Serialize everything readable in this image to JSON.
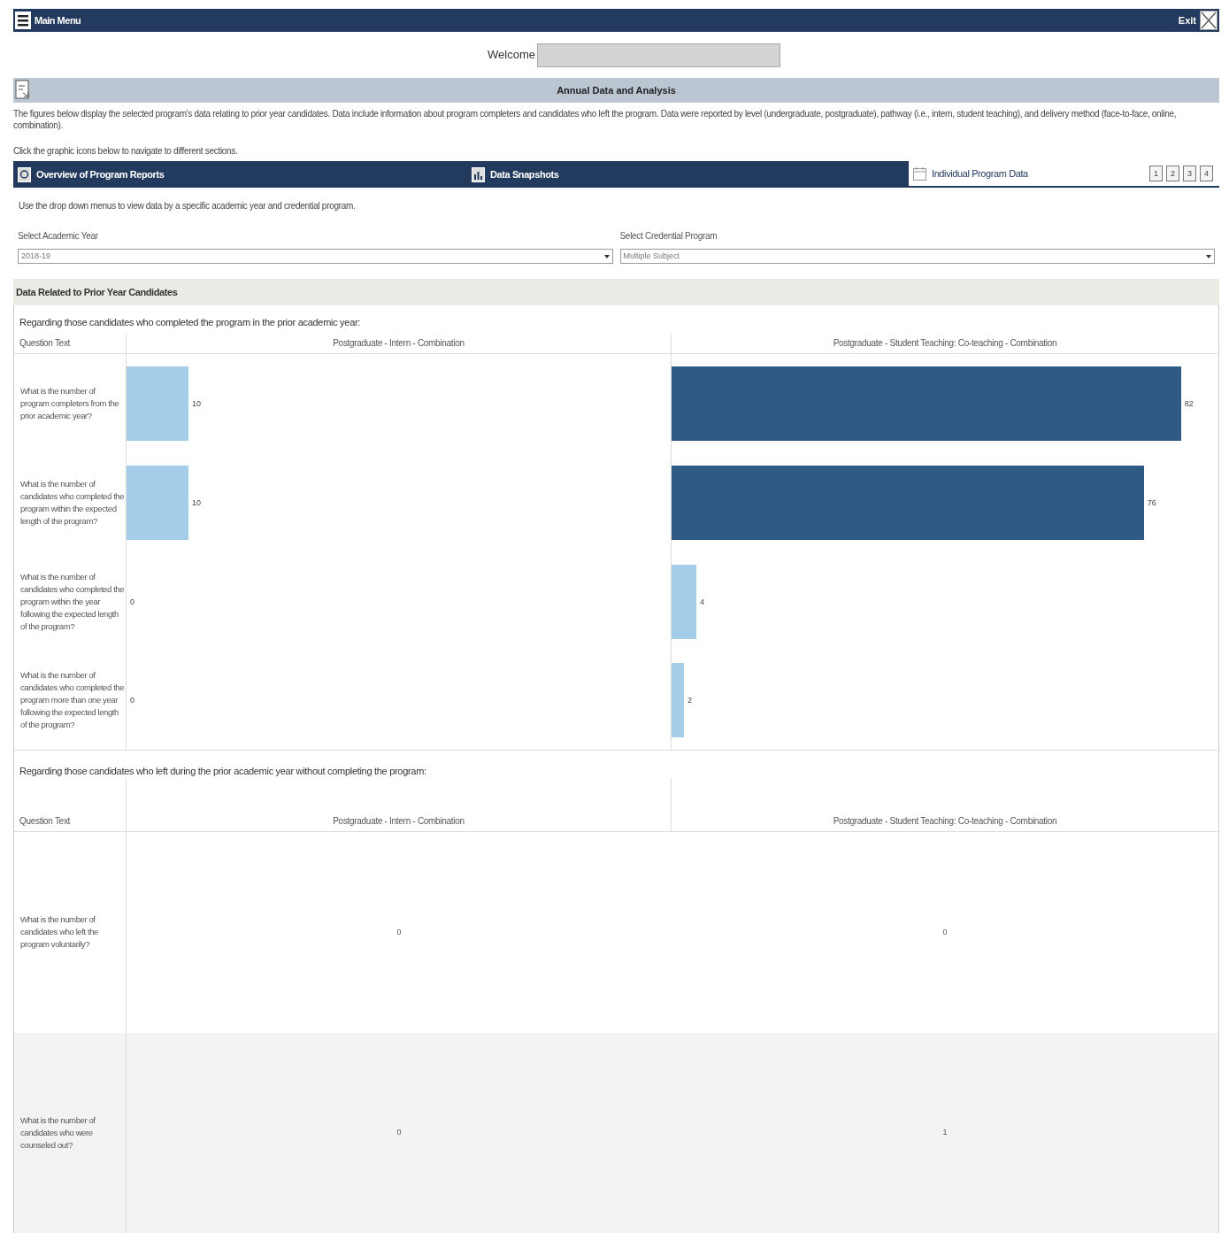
{
  "top_bar": {
    "menu_label": "Main Menu",
    "exit_label": "Exit"
  },
  "welcome": {
    "label": "Welcome"
  },
  "page_header": {
    "title": "Annual Data and Analysis"
  },
  "description": "The figures below display the selected program's data relating to prior year candidates. Data include information about program completers and candidates who left the program. Data were reported by level (undergraduate, postgraduate), pathway (i.e., intern, student teaching), and delivery method (face-to-face, online, combination).",
  "nav_hint": "Click the graphic icons below to navigate to different sections.",
  "nav_tabs": [
    {
      "label": "Overview of Program Reports",
      "selected": false
    },
    {
      "label": "Data Snapshots",
      "selected": false
    },
    {
      "label": "Individual Program Data",
      "selected": true
    }
  ],
  "page_buttons": [
    "1",
    "2",
    "3",
    "4"
  ],
  "filter_hint": "Use the drop down menus to view data by a specific academic year and credential program.",
  "filters": [
    {
      "label": "Select Academic Year",
      "value": "2018-19"
    },
    {
      "label": "Select Credential Program",
      "value": "Multiple Subject"
    }
  ],
  "section": {
    "title": "Data Related to Prior Year Candidates"
  },
  "completers_table": {
    "caption": "Regarding those candidates who completed the program in the prior academic year:",
    "question_header": "Question Text",
    "columns": [
      "Postgraduate - Intern - Combination",
      "Postgraduate - Student Teaching: Co-teaching - Combination"
    ],
    "rows": [
      {
        "question": "What is the number of program completers from the prior academic year?",
        "cells": [
          {
            "value": "10",
            "color": "#a3cde9"
          },
          {
            "value": "82",
            "color": "#2f5a86"
          }
        ]
      },
      {
        "question": "What is the number of candidates who completed the program within the expected length of the program?",
        "cells": [
          {
            "value": "10",
            "color": "#a3cde9"
          },
          {
            "value": "76",
            "color": "#2f5a86"
          }
        ]
      },
      {
        "question": "What is the number of candidates who completed the program within the year following the expected length of the program?",
        "cells": [
          {
            "value": "0"
          },
          {
            "value": "4",
            "color": "#a3cde9"
          }
        ]
      },
      {
        "question": "What is the number of candidates who completed the program more than one year following the expected length of the program?",
        "cells": [
          {
            "value": "0"
          },
          {
            "value": "2",
            "color": "#a3cde9"
          }
        ]
      }
    ]
  },
  "leavers_table": {
    "caption": "Regarding those candidates who left during the prior academic year without completing the program:",
    "question_header": "Question Text",
    "columns": [
      "Postgraduate - Intern - Combination",
      "Postgraduate - Student Teaching: Co-teaching - Combination"
    ],
    "rows": [
      {
        "question": "What is the number of candidates who left the program voluntarily?",
        "cells": [
          "0",
          "0"
        ]
      },
      {
        "question": "What is the number of candidates who were counseled out?",
        "cells": [
          "0",
          "1"
        ]
      }
    ]
  }
}
